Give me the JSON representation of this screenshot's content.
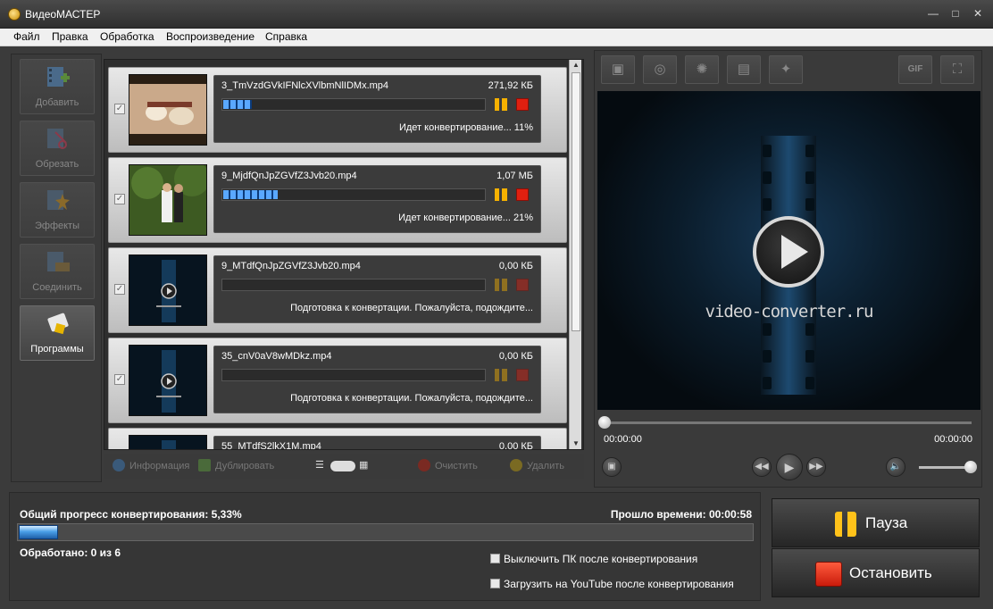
{
  "window": {
    "title": "ВидеоМАСТЕР",
    "minimize": "—",
    "maximize": "□",
    "close": "✕"
  },
  "menu": [
    "Файл",
    "Правка",
    "Обработка",
    "Воспроизведение",
    "Справка"
  ],
  "tools": [
    {
      "label": "Добавить",
      "icon": "add-film-icon"
    },
    {
      "label": "Обрезать",
      "icon": "cut-icon"
    },
    {
      "label": "Эффекты",
      "icon": "effects-icon"
    },
    {
      "label": "Соединить",
      "icon": "join-icon"
    },
    {
      "label": "Программы",
      "icon": "programs-icon"
    }
  ],
  "files": [
    {
      "name": "3_TmVzdGVkIFNlcXVlbmNlIDMx.mp4",
      "size": "271,92 КБ",
      "status": "Идет конвертирование... 11%",
      "progress": 0.11,
      "selected": true
    },
    {
      "name": "9_MjdfQnJpZGVfZ3Jvb20.mp4",
      "size": "1,07 МБ",
      "status": "Идет конвертирование... 21%",
      "progress": 0.21,
      "selected": true
    },
    {
      "name": "9_MTdfQnJpZGVfZ3Jvb20.mp4",
      "size": "0,00 КБ",
      "status": "Подготовка к конвертации. Пожалуйста, подождите...",
      "progress": 0,
      "selected": true
    },
    {
      "name": "35_cnV0aV8wMDkz.mp4",
      "size": "0,00 КБ",
      "status": "Подготовка к конвертации. Пожалуйста, подождите...",
      "progress": 0,
      "selected": true
    },
    {
      "name": "55_MTdfS2lkX1M.mp4",
      "size": "0,00 КБ",
      "status": "",
      "progress": 0,
      "selected": true
    }
  ],
  "list_toolbar": {
    "info": "Информация",
    "duplicate": "Дублировать",
    "clear": "Очистить",
    "delete": "Удалить"
  },
  "preview": {
    "watermark": "video-converter.ru",
    "time_start": "00:00:00",
    "time_end": "00:00:00",
    "gif": "GIF"
  },
  "bottom": {
    "total_label": "Общий прогресс конвертирования: 5,33%",
    "total_progress": 0.0533,
    "elapsed": "Прошло времени: 00:00:58",
    "processed": "Обработано: 0 из 6",
    "opt_shutdown": "Выключить ПК после конвертирования",
    "opt_youtube": "Загрузить на YouTube после конвертирования"
  },
  "actions": {
    "pause": "Пауза",
    "stop": "Остановить"
  },
  "colors": {
    "accent_blue": "#4aa0e8",
    "pause": "#ffc21a",
    "stop": "#e02010"
  }
}
